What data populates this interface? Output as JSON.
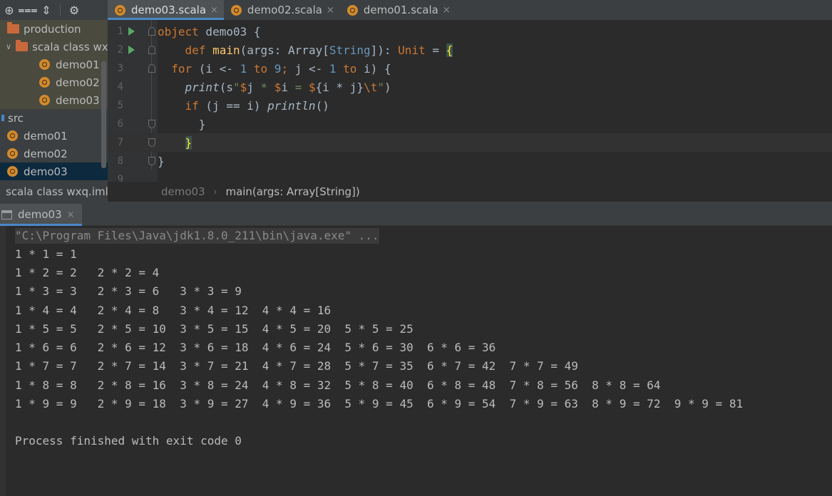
{
  "toolbar": {
    "icons": [
      "target-icon",
      "collapse-all-icon",
      "expand-all-icon",
      "gear-icon"
    ]
  },
  "tabs": [
    {
      "label": "demo03.scala",
      "active": true,
      "close": "×"
    },
    {
      "label": "demo02.scala",
      "active": false,
      "close": "×"
    },
    {
      "label": "demo01.scala",
      "active": false,
      "close": "×"
    }
  ],
  "tree": {
    "production": "production",
    "module_folder": "scala class wx",
    "out_files": [
      "demo01",
      "demo02",
      "demo03"
    ],
    "src": "src",
    "src_files": [
      "demo01",
      "demo02",
      "demo03"
    ],
    "iml": "scala class wxq.iml"
  },
  "editor": {
    "line_numbers": [
      "1",
      "2",
      "3",
      "4",
      "5",
      "6",
      "7",
      "8",
      "9"
    ]
  },
  "breadcrumb": {
    "object": "demo03",
    "method": "main(args: Array[String])"
  },
  "run": {
    "tab_label": "demo03",
    "tab_close": "×",
    "lines": [
      "\"C:\\Program Files\\Java\\jdk1.8.0_211\\bin\\java.exe\" ...",
      "1 * 1 = 1",
      "1 * 2 = 2   2 * 2 = 4",
      "1 * 3 = 3   2 * 3 = 6   3 * 3 = 9",
      "1 * 4 = 4   2 * 4 = 8   3 * 4 = 12  4 * 4 = 16",
      "1 * 5 = 5   2 * 5 = 10  3 * 5 = 15  4 * 5 = 20  5 * 5 = 25",
      "1 * 6 = 6   2 * 6 = 12  3 * 6 = 18  4 * 6 = 24  5 * 6 = 30  6 * 6 = 36",
      "1 * 7 = 7   2 * 7 = 14  3 * 7 = 21  4 * 7 = 28  5 * 7 = 35  6 * 7 = 42  7 * 7 = 49",
      "1 * 8 = 8   2 * 8 = 16  3 * 8 = 24  4 * 8 = 32  5 * 8 = 40  6 * 8 = 48  7 * 8 = 56  8 * 8 = 64",
      "1 * 9 = 9   2 * 9 = 18  3 * 9 = 27  4 * 9 = 36  5 * 9 = 45  6 * 9 = 54  7 * 9 = 63  8 * 9 = 72  9 * 9 = 81",
      "",
      "Process finished with exit code 0"
    ]
  },
  "colors": {
    "keyword": "#cc7832",
    "function": "#ffc66d",
    "number": "#6897bb",
    "string": "#6a8759",
    "accent": "#4a88c7",
    "object_icon": "#d28a2d",
    "folder": "#c9693b",
    "run_arrow": "#59a869"
  }
}
